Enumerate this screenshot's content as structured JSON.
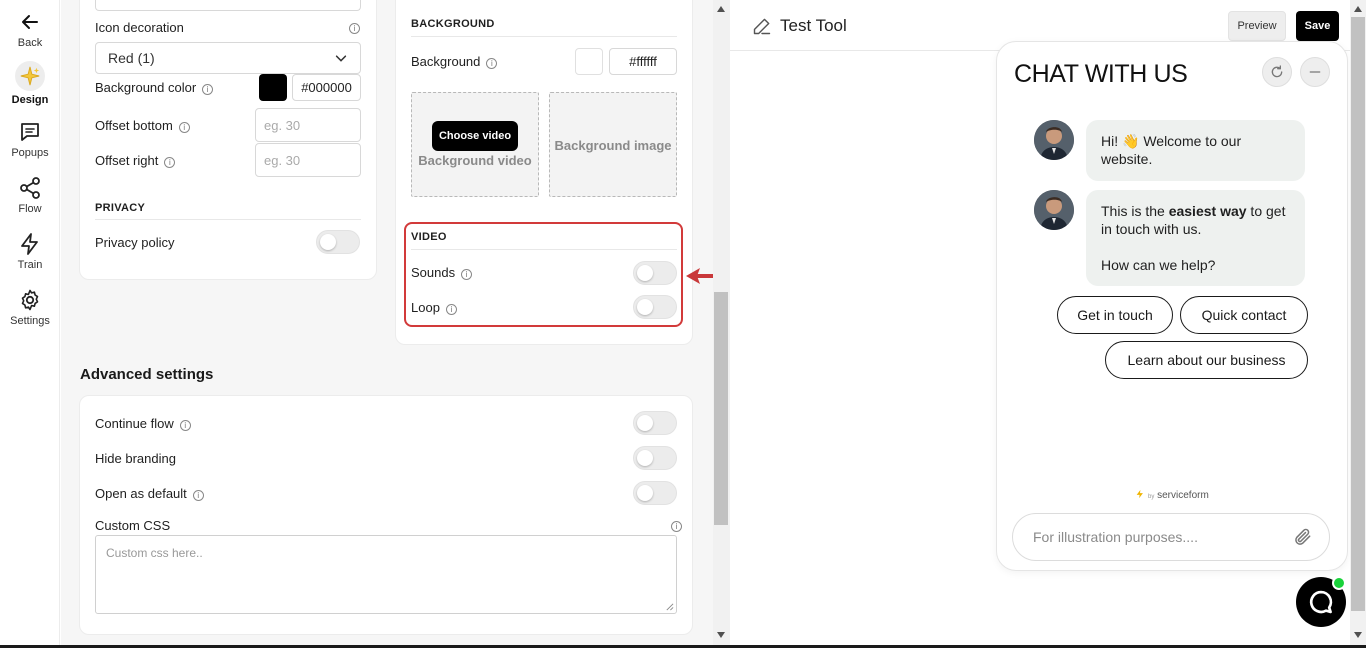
{
  "sidebar": {
    "items": [
      {
        "label": "Back",
        "icon": "arrow-left-icon"
      },
      {
        "label": "Design",
        "icon": "sparkle-icon",
        "active": true
      },
      {
        "label": "Popups",
        "icon": "chat-bubble-icon"
      },
      {
        "label": "Flow",
        "icon": "share-nodes-icon"
      },
      {
        "label": "Train",
        "icon": "lightning-icon"
      },
      {
        "label": "Settings",
        "icon": "gear-icon"
      }
    ]
  },
  "left_panel": {
    "icon_decoration": {
      "label": "Icon decoration",
      "value": "Red (1)"
    },
    "background_color": {
      "label": "Background color",
      "value": "#000000",
      "swatch": "#000000"
    },
    "offset_bottom": {
      "label": "Offset bottom",
      "placeholder": "eg. 30"
    },
    "offset_right": {
      "label": "Offset right",
      "placeholder": "eg. 30"
    },
    "privacy": {
      "title": "PRIVACY",
      "policy_label": "Privacy policy",
      "policy_on": false
    }
  },
  "right_panel": {
    "background_title": "BACKGROUND",
    "background": {
      "label": "Background",
      "value": "#ffffff",
      "swatch": "#ffffff"
    },
    "background_video": {
      "caption": "Background video",
      "button": "Choose video"
    },
    "background_image": {
      "caption": "Background image"
    },
    "video": {
      "title": "VIDEO",
      "sounds_label": "Sounds",
      "sounds_on": false,
      "loop_label": "Loop",
      "loop_on": false
    }
  },
  "advanced": {
    "title": "Advanced settings",
    "continue_flow": "Continue flow",
    "hide_branding": "Hide branding",
    "open_as_default": "Open as default",
    "custom_css_label": "Custom CSS",
    "custom_css_placeholder": "Custom css here.."
  },
  "preview": {
    "tool_name": "Test Tool",
    "preview_button": "Preview",
    "save_button": "Save",
    "chat": {
      "title": "CHAT WITH US",
      "messages": [
        {
          "text": "Hi! 👋 Welcome to our website."
        },
        {
          "prefix": "This is the ",
          "bold": "easiest way",
          "suffix": " to get in touch with us.",
          "second": "How can we help?"
        }
      ],
      "quick_replies": [
        "Get in touch",
        "Quick contact",
        "Learn about our business"
      ],
      "powered_by_small": "by",
      "powered_by": "serviceform",
      "input_placeholder": "For illustration purposes...."
    }
  },
  "colors": {
    "highlight": "#d23a3a",
    "online": "#19d23a",
    "accent": "#000000"
  }
}
